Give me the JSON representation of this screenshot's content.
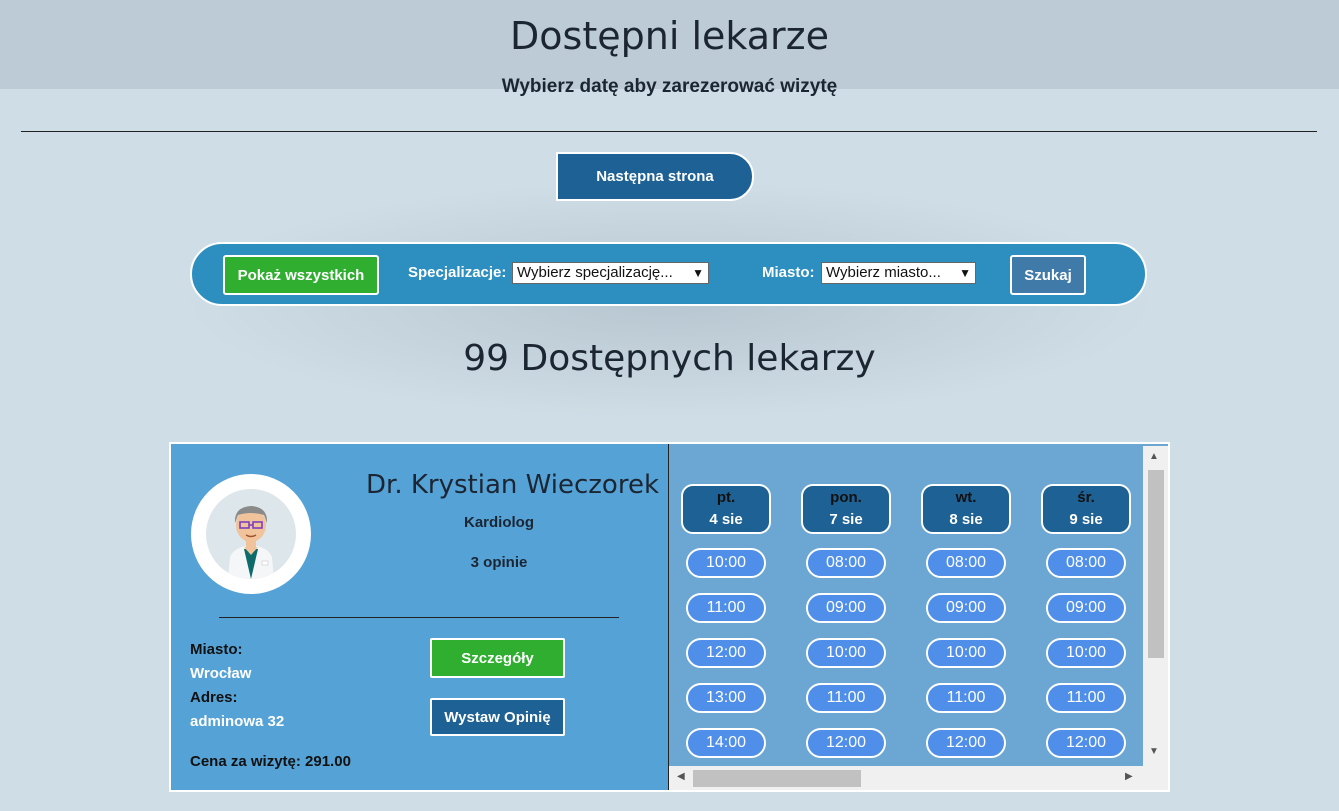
{
  "header": {
    "title": "Dostępni lekarze",
    "subtitle": "Wybierz datę aby zarezerować wizytę"
  },
  "pagination": {
    "next_label": "Następna strona"
  },
  "filters": {
    "show_all_label": "Pokaż wszystkich",
    "spec_label": "Specjalizacje:",
    "spec_value": "Wybierz specjalizację...",
    "city_label": "Miasto:",
    "city_value": "Wybierz miasto...",
    "search_label": "Szukaj"
  },
  "results": {
    "count_text": "99 Dostępnych lekarzy"
  },
  "doctor": {
    "name": "Dr. Krystian Wieczorek",
    "specialization": "Kardiolog",
    "reviews": "3 opinie",
    "city_label": "Miasto:",
    "city": "Wrocław",
    "address_label": "Adres:",
    "address": "adminowa 32",
    "price_text": "Cena za wizytę: 291.00",
    "details_label": "Szczegóły",
    "review_label": "Wystaw Opinię",
    "avatar": "doctor-avatar-icon"
  },
  "schedule": {
    "days": [
      {
        "dayname": "pt.",
        "date": "4 sie",
        "slots": [
          "10:00",
          "11:00",
          "12:00",
          "13:00",
          "14:00"
        ]
      },
      {
        "dayname": "pon.",
        "date": "7 sie",
        "slots": [
          "08:00",
          "09:00",
          "10:00",
          "11:00",
          "12:00"
        ]
      },
      {
        "dayname": "wt.",
        "date": "8 sie",
        "slots": [
          "08:00",
          "09:00",
          "10:00",
          "11:00",
          "12:00"
        ]
      },
      {
        "dayname": "śr.",
        "date": "9 sie",
        "slots": [
          "08:00",
          "09:00",
          "10:00",
          "11:00",
          "12:00"
        ]
      }
    ]
  },
  "colors": {
    "primary": "#1e6194",
    "success": "#2fae2f",
    "slot": "#4f8fe9",
    "card": "#55a2d6",
    "filter_bar": "#2d8fc0"
  }
}
